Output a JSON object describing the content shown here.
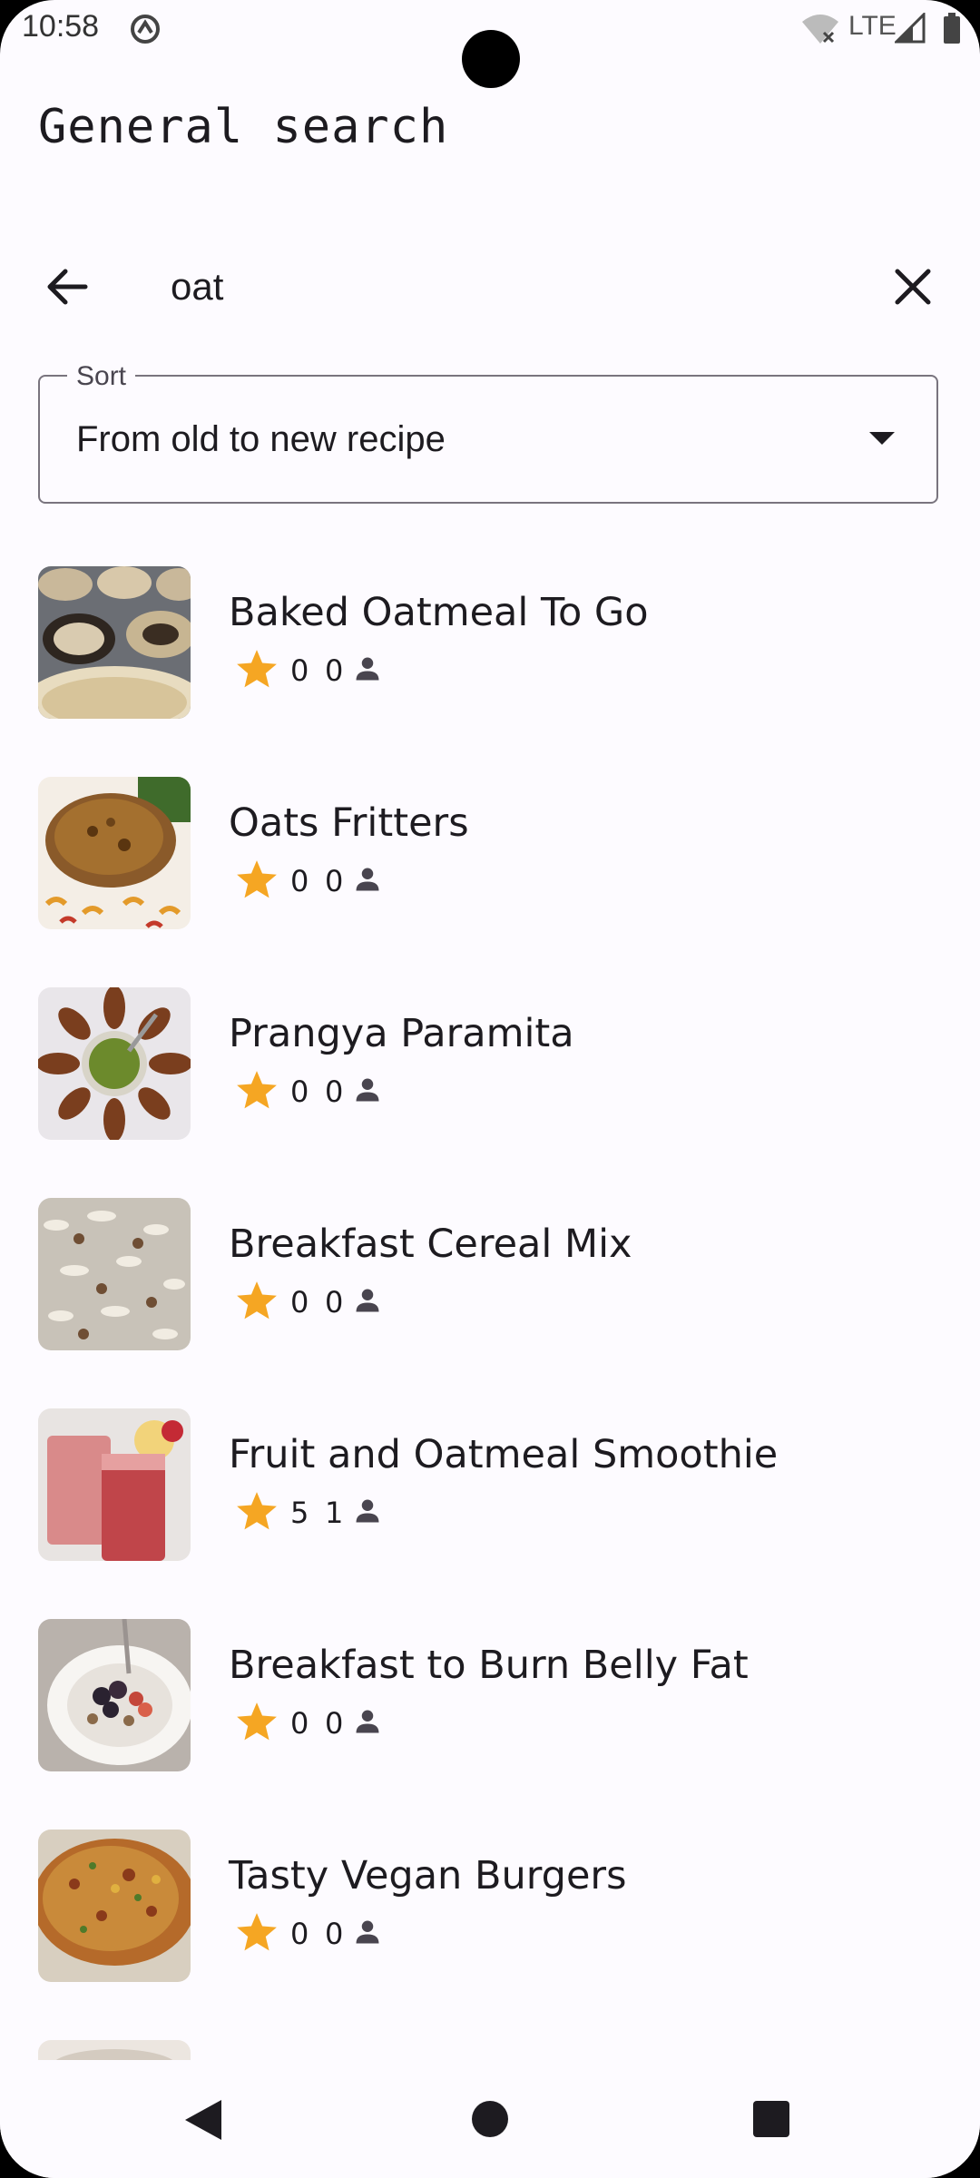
{
  "status": {
    "time": "10:58",
    "network": "LTE"
  },
  "page": {
    "title": "General search"
  },
  "search": {
    "query": "oat",
    "placeholder": ""
  },
  "sort": {
    "label": "Sort",
    "selected": "From old to new recipe"
  },
  "colors": {
    "star": "#f5a623",
    "text": "#1d1b20"
  },
  "recipes": [
    {
      "name": "Baked Oatmeal To Go",
      "rating": "0",
      "count": "0"
    },
    {
      "name": "Oats Fritters",
      "rating": "0",
      "count": "0"
    },
    {
      "name": "Prangya Paramita",
      "rating": "0",
      "count": "0"
    },
    {
      "name": "Breakfast Cereal Mix",
      "rating": "0",
      "count": "0"
    },
    {
      "name": "Fruit and Oatmeal Smoothie",
      "rating": "5",
      "count": "1"
    },
    {
      "name": "Breakfast to Burn Belly Fat",
      "rating": "0",
      "count": "0"
    },
    {
      "name": "Tasty Vegan Burgers",
      "rating": "0",
      "count": "0"
    }
  ]
}
